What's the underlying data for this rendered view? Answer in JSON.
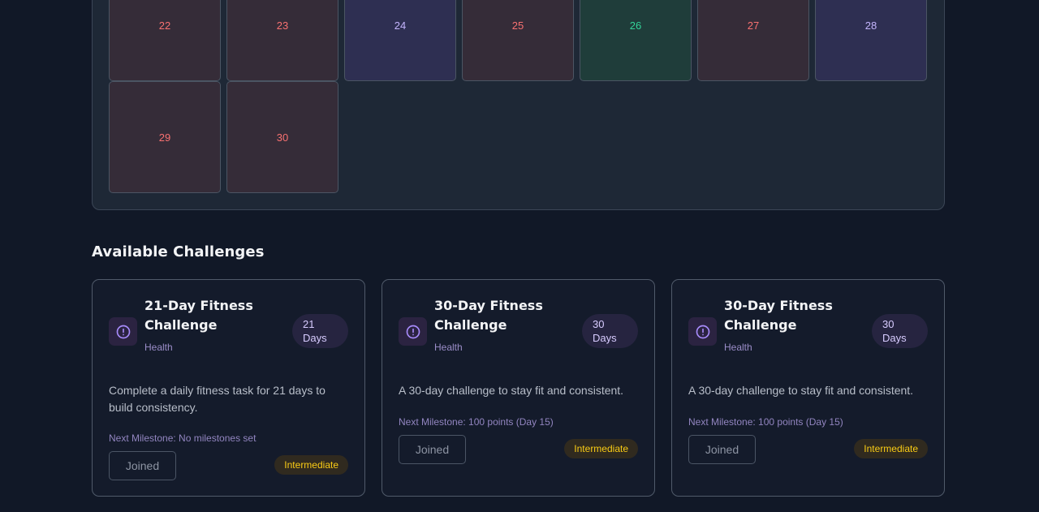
{
  "calendar": {
    "days": [
      {
        "label": "22",
        "status": "missed"
      },
      {
        "label": "23",
        "status": "missed"
      },
      {
        "label": "24",
        "status": "upcoming"
      },
      {
        "label": "25",
        "status": "missed"
      },
      {
        "label": "26",
        "status": "completed"
      },
      {
        "label": "27",
        "status": "missed"
      },
      {
        "label": "28",
        "status": "upcoming"
      },
      {
        "label": "29",
        "status": "missed"
      },
      {
        "label": "30",
        "status": "missed"
      }
    ]
  },
  "challenges_section": {
    "title": "Available Challenges"
  },
  "challenges": [
    {
      "title": "21-Day Fitness Challenge",
      "category": "Health",
      "duration": "21 Days",
      "description": "Complete a daily fitness task for 21 days to build consistency.",
      "milestone": "Next Milestone: No milestones set",
      "action_label": "Joined",
      "level": "Intermediate",
      "icon": "alert-circle-icon"
    },
    {
      "title": "30-Day Fitness Challenge",
      "category": "Health",
      "duration": "30 Days",
      "description": "A 30-day challenge to stay fit and consistent.",
      "milestone": "Next Milestone: 100 points (Day 15)",
      "action_label": "Joined",
      "level": "Intermediate",
      "icon": "alert-circle-icon"
    },
    {
      "title": "30-Day Fitness Challenge",
      "category": "Health",
      "duration": "30 Days",
      "description": "A 30-day challenge to stay fit and consistent.",
      "milestone": "Next Milestone: 100 points (Day 15)",
      "action_label": "Joined",
      "level": "Intermediate",
      "icon": "alert-circle-icon"
    }
  ],
  "colors": {
    "background": "#111827",
    "panel": "#1e2836",
    "missed_text": "#f87171",
    "upcoming_text": "#c4b5fd",
    "completed_text": "#34d399",
    "accent_purple": "#a78bfa",
    "badge_yellow": "#facc15"
  }
}
